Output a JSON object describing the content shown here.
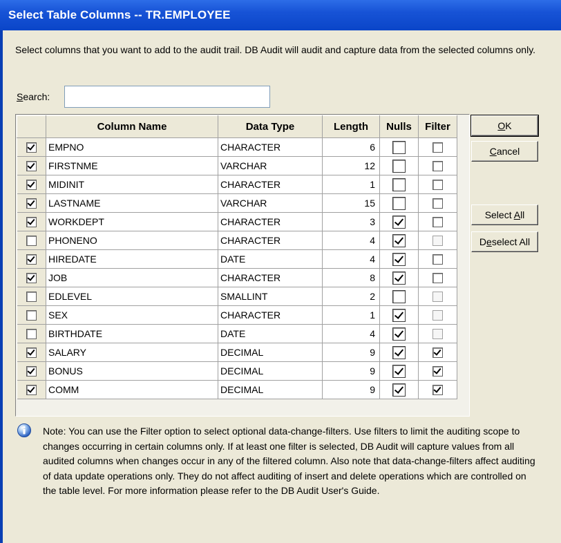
{
  "window": {
    "title": "Select Table Columns -- TR.EMPLOYEE"
  },
  "intro": "Select columns that you want to add to the audit trail. DB Audit will audit and capture data from the selected columns only.",
  "search": {
    "label_pre": "",
    "label_accel": "S",
    "label_post": "earch:",
    "value": ""
  },
  "grid": {
    "headers": {
      "select": "",
      "column_name": "Column Name",
      "data_type": "Data Type",
      "length": "Length",
      "nulls": "Nulls",
      "filter": "Filter"
    },
    "rows": [
      {
        "selected": true,
        "name": "EMPNO",
        "type": "CHARACTER",
        "length": "6",
        "nulls": false,
        "filter": false,
        "filter_enabled": true
      },
      {
        "selected": true,
        "name": "FIRSTNME",
        "type": "VARCHAR",
        "length": "12",
        "nulls": false,
        "filter": false,
        "filter_enabled": true
      },
      {
        "selected": true,
        "name": "MIDINIT",
        "type": "CHARACTER",
        "length": "1",
        "nulls": false,
        "filter": false,
        "filter_enabled": true
      },
      {
        "selected": true,
        "name": "LASTNAME",
        "type": "VARCHAR",
        "length": "15",
        "nulls": false,
        "filter": false,
        "filter_enabled": true
      },
      {
        "selected": true,
        "name": "WORKDEPT",
        "type": "CHARACTER",
        "length": "3",
        "nulls": true,
        "filter": false,
        "filter_enabled": true
      },
      {
        "selected": false,
        "name": "PHONENO",
        "type": "CHARACTER",
        "length": "4",
        "nulls": true,
        "filter": false,
        "filter_enabled": false
      },
      {
        "selected": true,
        "name": "HIREDATE",
        "type": "DATE",
        "length": "4",
        "nulls": true,
        "filter": false,
        "filter_enabled": true
      },
      {
        "selected": true,
        "name": "JOB",
        "type": "CHARACTER",
        "length": "8",
        "nulls": true,
        "filter": false,
        "filter_enabled": true
      },
      {
        "selected": false,
        "name": "EDLEVEL",
        "type": "SMALLINT",
        "length": "2",
        "nulls": false,
        "filter": false,
        "filter_enabled": false
      },
      {
        "selected": false,
        "name": "SEX",
        "type": "CHARACTER",
        "length": "1",
        "nulls": true,
        "filter": false,
        "filter_enabled": false
      },
      {
        "selected": false,
        "name": "BIRTHDATE",
        "type": "DATE",
        "length": "4",
        "nulls": true,
        "filter": false,
        "filter_enabled": false
      },
      {
        "selected": true,
        "name": "SALARY",
        "type": "DECIMAL",
        "length": "9",
        "nulls": true,
        "filter": true,
        "filter_enabled": true
      },
      {
        "selected": true,
        "name": "BONUS",
        "type": "DECIMAL",
        "length": "9",
        "nulls": true,
        "filter": true,
        "filter_enabled": true
      },
      {
        "selected": true,
        "name": "COMM",
        "type": "DECIMAL",
        "length": "9",
        "nulls": true,
        "filter": true,
        "filter_enabled": true
      }
    ]
  },
  "buttons": {
    "ok": {
      "accel": "O",
      "rest": "K"
    },
    "cancel": {
      "accel": "C",
      "rest": "ancel"
    },
    "select_all": {
      "pre": "Select ",
      "accel": "A",
      "rest": "ll"
    },
    "deselect_all": {
      "pre": "D",
      "accel": "e",
      "rest": "select All"
    }
  },
  "note": "Note:  You can use the Filter option to select optional data-change-filters. Use filters to limit the auditing scope to changes occurring in certain columns only. If at least one filter is selected, DB Audit will capture values from all audited columns when changes occur in any of the filtered column. Also note that data-change-filters affect auditing of data update operations only. They do not affect auditing of insert and delete operations which are controlled on the table level. For more information please refer to the DB Audit User's Guide.",
  "icons": {
    "note": "info-icon"
  },
  "colors": {
    "titlebar": "#0A45C8",
    "dialog_bg": "#ECE9D8"
  }
}
